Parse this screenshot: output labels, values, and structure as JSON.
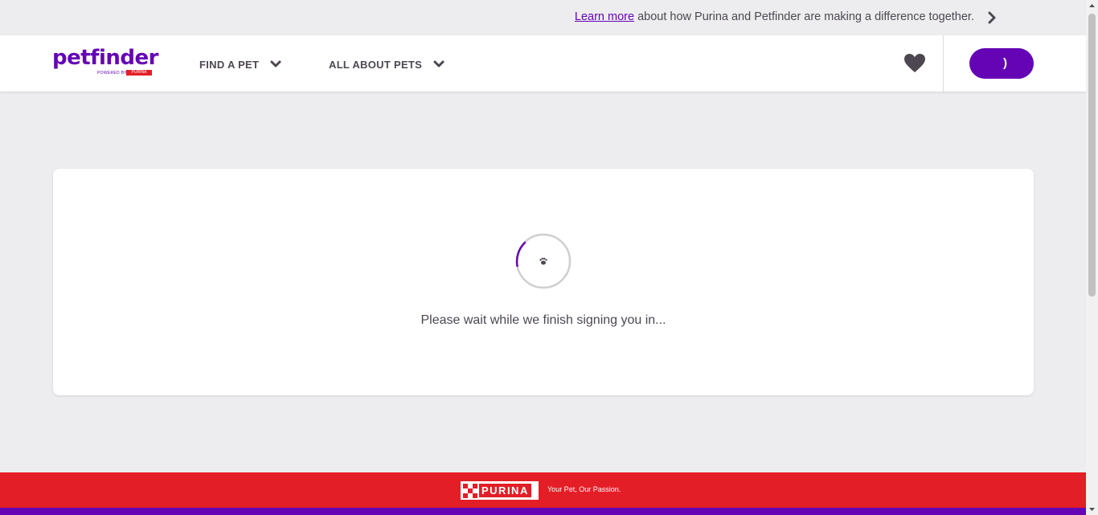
{
  "topbar": {
    "link_text": "Learn more",
    "message": " about how Purina and Petfinder are making a difference together."
  },
  "header": {
    "logo_text": "petfinder",
    "logo_sub": "POWERED BY",
    "logo_brand": "PURINA",
    "nav": [
      {
        "label": "FIND A PET"
      },
      {
        "label": "ALL ABOUT PETS"
      }
    ],
    "account_button_text": ")"
  },
  "main": {
    "wait_message": "Please wait while we finish signing you in..."
  },
  "footer": {
    "brand": "PURINA",
    "tagline": "Your Pet, Our Passion."
  },
  "colors": {
    "brand_purple": "#6504b5",
    "purina_red": "#e41e26",
    "text_dark": "#4d4751",
    "background": "#ededef"
  }
}
